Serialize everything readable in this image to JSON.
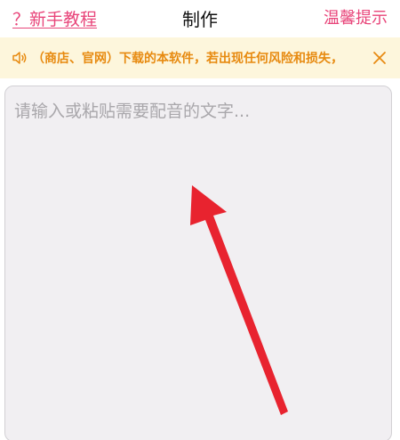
{
  "navbar": {
    "left_link": "？新手教程",
    "title": "制作",
    "right_link": "温馨提示"
  },
  "notice": {
    "icon": "speaker-icon",
    "text": "（商店、官网）下载的本软件，若出现任何风险和损失，",
    "close_icon": "close-icon"
  },
  "input": {
    "placeholder": "请输入或粘贴需要配音的文字...",
    "value": ""
  },
  "annotation": {
    "arrow_icon": "red-arrow-icon",
    "arrow_color": "#e8232f"
  },
  "colors": {
    "accent_pink": "#e8457a",
    "notice_bg": "#fdf6dc",
    "notice_text": "#e78a10",
    "input_bg": "#f1eff2"
  }
}
